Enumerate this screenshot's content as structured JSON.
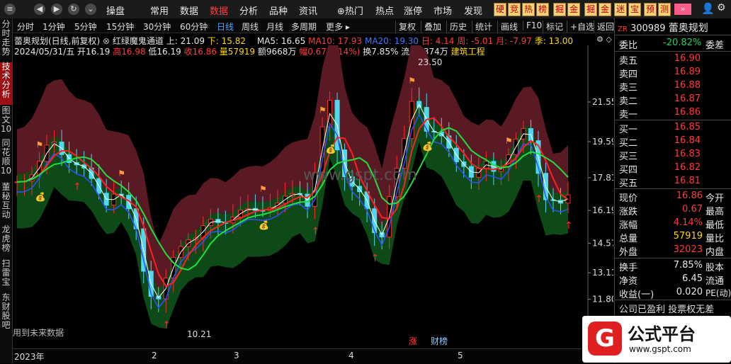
{
  "topbar": {
    "menus": [
      "操盘",
      "常用",
      "数据",
      "数据",
      "分析",
      "品种",
      "资讯",
      "热门",
      "热点",
      "涨停",
      "市场",
      "发现"
    ],
    "active_menu_index": 3,
    "tags": [
      "硬",
      "竞",
      "热",
      "榜",
      "掘",
      "金",
      "掘",
      "金",
      "迷",
      "宝",
      "预",
      "测"
    ],
    "hot_prefix": "⊕"
  },
  "left_tabs": [
    {
      "label": "分时走势",
      "active": false
    },
    {
      "label": "技术分析",
      "active": true
    },
    {
      "label": "图文10",
      "active": false
    },
    {
      "label": "同花顺10",
      "active": false
    },
    {
      "label": "董秘互动",
      "active": false
    },
    {
      "label": "龙虎榜",
      "active": false
    },
    {
      "label": "扫雷宝",
      "active": false
    },
    {
      "label": "东财股吧",
      "active": false
    }
  ],
  "period_bar": {
    "items": [
      "分时",
      "1分钟",
      "5分钟",
      "15分钟",
      "30分钟",
      "60分钟",
      "日线",
      "周线",
      "月线",
      "多周期",
      "更多 ▸"
    ],
    "active_index": 6,
    "right_items": [
      "复权",
      "叠加",
      "历史",
      "统计",
      "画线",
      "F10",
      "标记",
      "+自选",
      "返回"
    ]
  },
  "info_line1": {
    "title": "蕾奥规划(日线,前复权)",
    "indicator": "红绿魔鬼通道",
    "up_label": "上: 21.09",
    "down_label": "下: 15.82",
    "ma5": "MA5: 16.65",
    "ma10": "MA10: 17.93",
    "ma20": "MA20: 19.30",
    "day": "日: 4.14",
    "week": "周: -5.01",
    "month": "月: -7.97",
    "season": "季: 13.00"
  },
  "info_line2": {
    "date": "2024/05/31/五",
    "open": "开16.19",
    "high": "高16.98",
    "low": "低16.19",
    "close": "收16.86",
    "vol": "量57919",
    "amount": "额9668万",
    "amp": "幅0.67(4.14%)",
    "turn": "换7.85%",
    "float": "流通7374万",
    "industry": "建筑工程"
  },
  "chart": {
    "price_ticks": [
      "21.55",
      "19.59",
      "17.81",
      "16.19",
      "14.57",
      "13.11",
      "11.80"
    ],
    "high_label": "23.50",
    "low_label": "10.21",
    "future_hint": "用到未来数据",
    "watermark": "www.gspt.com",
    "x_labels": [
      "2023年",
      "2",
      "3",
      "4",
      "5"
    ],
    "badge_zhang": "涨",
    "badge_caibang": "财榜"
  },
  "chart_data": {
    "type": "candlestick",
    "title": "红绿魔鬼通道",
    "x_labels": [
      "2023年",
      "2",
      "3",
      "4",
      "5"
    ],
    "ylim": [
      10.21,
      23.5
    ],
    "y_ticks": [
      11.8,
      13.11,
      14.57,
      16.19,
      17.81,
      19.59,
      21.55
    ],
    "series": [
      {
        "name": "MA5",
        "last": 16.65
      },
      {
        "name": "MA10",
        "last": 17.93
      },
      {
        "name": "MA20",
        "last": 19.3
      }
    ],
    "channel": {
      "upper": 21.09,
      "lower": 15.82
    },
    "high": 23.5,
    "low": 10.21
  },
  "right_panel": {
    "code": "300989",
    "name": "蕾奥规划",
    "weibi_label": "委比",
    "weibi_value": "-20.82%",
    "weicha_label": "委差",
    "asks": [
      {
        "label": "卖五",
        "price": "16.90"
      },
      {
        "label": "卖四",
        "price": "16.89"
      },
      {
        "label": "卖三",
        "price": "16.88"
      },
      {
        "label": "卖二",
        "price": "16.87"
      },
      {
        "label": "卖一",
        "price": "16.86"
      }
    ],
    "bids": [
      {
        "label": "买一",
        "price": "16.85"
      },
      {
        "label": "买二",
        "price": "16.84"
      },
      {
        "label": "买三",
        "price": "16.83"
      },
      {
        "label": "买四",
        "price": "16.82"
      },
      {
        "label": "买五",
        "price": "16.81"
      }
    ],
    "stats": [
      {
        "label": "现价",
        "value": "16.86",
        "cls": "red",
        "tail": "今开"
      },
      {
        "label": "涨跌",
        "value": "0.67",
        "cls": "red",
        "tail": "最高"
      },
      {
        "label": "涨幅",
        "value": "4.14%",
        "cls": "red",
        "tail": "最低"
      },
      {
        "label": "总量",
        "value": "57919",
        "cls": "yellow",
        "tail": "量比"
      },
      {
        "label": "外盘",
        "value": "32023",
        "cls": "red",
        "tail": "内盘"
      }
    ],
    "stats2": [
      {
        "label": "换手",
        "value": "7.85%",
        "tail": "股本"
      },
      {
        "label": "净资",
        "value": "6.45",
        "tail": "流通"
      },
      {
        "label": "收益(一)",
        "value": "0.020",
        "tail": "PE(动)"
      }
    ],
    "footer": "公司已盈利 投票权无差",
    "logo_text": "公式平台",
    "logo_url": "www.gspt.com"
  }
}
